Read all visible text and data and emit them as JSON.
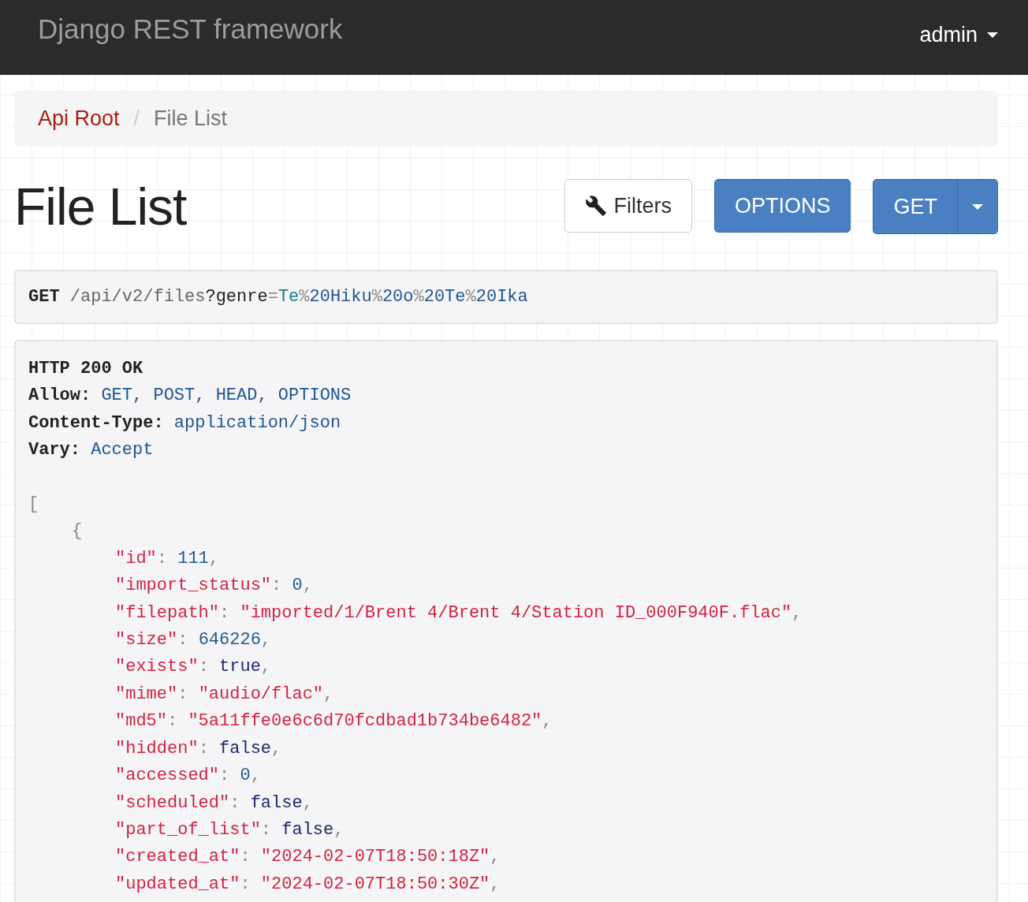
{
  "navbar": {
    "brand": "Django REST framework",
    "user_menu": {
      "label": "admin"
    }
  },
  "breadcrumbs": [
    {
      "label": "Api Root",
      "selected": false
    },
    {
      "label": "/",
      "kind": "divider"
    },
    {
      "label": "File List",
      "selected": true
    }
  ],
  "title": "File List",
  "buttons": [
    {
      "kind": "filters",
      "label": "Filters"
    },
    {
      "kind": "primary",
      "label": "OPTIONS"
    },
    {
      "kind": "split",
      "label": "GET"
    }
  ],
  "request": {
    "method": "GET",
    "url": [
      {
        "text": "/api/v2/files",
        "kind": "plain"
      },
      {
        "text": "?genre",
        "kind": "key"
      },
      {
        "text": "=",
        "kind": "punct"
      },
      {
        "text": "Te",
        "kind": "type"
      },
      {
        "text": "%",
        "kind": "punct"
      },
      {
        "text": "20Hiku",
        "kind": "literal"
      },
      {
        "text": "%",
        "kind": "punct"
      },
      {
        "text": "20o",
        "kind": "literal"
      },
      {
        "text": "%",
        "kind": "punct"
      },
      {
        "text": "20Te",
        "kind": "literal"
      },
      {
        "text": "%",
        "kind": "punct"
      },
      {
        "text": "20Ika",
        "kind": "literal"
      }
    ]
  },
  "response": {
    "status": "HTTP 200 OK",
    "headers": [
      {
        "name": "Allow:",
        "value": "GET, POST, HEAD, OPTIONS"
      },
      {
        "name": "Content-Type:",
        "value": "application/json"
      },
      {
        "name": "Vary:",
        "value": "Accept"
      }
    ],
    "body": {
      "open": "[",
      "children": [
        {
          "open": "{",
          "fields": [
            {
              "key": "\"id\"",
              "colon": ":",
              "value": "111",
              "kind": "number",
              "comma": ","
            },
            {
              "key": "\"import_status\"",
              "colon": ":",
              "value": "0",
              "kind": "number",
              "comma": ","
            },
            {
              "key": "\"filepath\"",
              "colon": ":",
              "value": "\"imported/1/Brent 4/Brent 4/Station ID_000F940F.flac\"",
              "kind": "string",
              "comma": ","
            },
            {
              "key": "\"size\"",
              "colon": ":",
              "value": "646226",
              "kind": "number",
              "comma": ","
            },
            {
              "key": "\"exists\"",
              "colon": ":",
              "value": "true",
              "kind": "literal",
              "comma": ","
            },
            {
              "key": "\"mime\"",
              "colon": ":",
              "value": "\"audio/flac\"",
              "kind": "string",
              "comma": ","
            },
            {
              "key": "\"md5\"",
              "colon": ":",
              "value": "\"5a11ffe0e6c6d70fcdbad1b734be6482\"",
              "kind": "string",
              "comma": ","
            },
            {
              "key": "\"hidden\"",
              "colon": ":",
              "value": "false",
              "kind": "literal",
              "comma": ","
            },
            {
              "key": "\"accessed\"",
              "colon": ":",
              "value": "0",
              "kind": "number",
              "comma": ","
            },
            {
              "key": "\"scheduled\"",
              "colon": ":",
              "value": "false",
              "kind": "literal",
              "comma": ","
            },
            {
              "key": "\"part_of_list\"",
              "colon": ":",
              "value": "false",
              "kind": "literal",
              "comma": ","
            },
            {
              "key": "\"created_at\"",
              "colon": ":",
              "value": "\"2024-02-07T18:50:18Z\"",
              "kind": "string",
              "comma": ","
            },
            {
              "key": "\"updated_at\"",
              "colon": ":",
              "value": "\"2024-02-07T18:50:30Z\"",
              "kind": "string",
              "comma": ","
            }
          ]
        }
      ]
    }
  }
}
